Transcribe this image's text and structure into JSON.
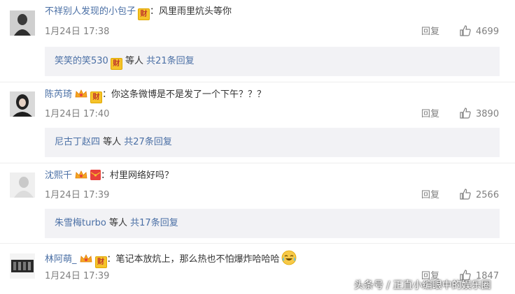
{
  "comments": [
    {
      "username": "不祥别人发现的小包子",
      "badges": [
        "财"
      ],
      "text": "：风里雨里炕头等你",
      "date": "1月24日 17:38",
      "reply_label": "回复",
      "likes": "4699",
      "sub": {
        "users": "笑笑的笑530",
        "badge": "财",
        "suffix": " 等人 ",
        "count": "共21条回复"
      }
    },
    {
      "username": "陈芮琦",
      "badges": [
        "crown",
        "财"
      ],
      "text": "：你这条微博是不是发了一个下午？？？",
      "date": "1月24日 17:40",
      "reply_label": "回复",
      "likes": "3890",
      "sub": {
        "users": "尼古丁赵四",
        "suffix": " 等人 ",
        "count": "共27条回复"
      }
    },
    {
      "username": "沈熙千",
      "badges": [
        "crown",
        "red-envelope"
      ],
      "text": "：村里网络好吗？",
      "date": "1月24日 17:39",
      "reply_label": "回复",
      "likes": "2566",
      "sub": {
        "users": "朱雪梅turbo",
        "suffix": " 等人 ",
        "count": "共17条回复"
      }
    },
    {
      "username": "林阿萌_",
      "badges": [
        "crown",
        "财"
      ],
      "text": "：笔记本放炕上，那么热也不怕爆炸哈哈哈",
      "emoji": "laugh-cry-emoji",
      "date": "1月24日 17:39",
      "reply_label": "回复",
      "likes": "1847"
    }
  ],
  "watermark": "头条号 / 正直小编眼中的娱乐圈",
  "colors": {
    "username": "#eb7350",
    "link": "#4a6fa5",
    "meta": "#808080",
    "subbox": "#f2f2f5"
  }
}
